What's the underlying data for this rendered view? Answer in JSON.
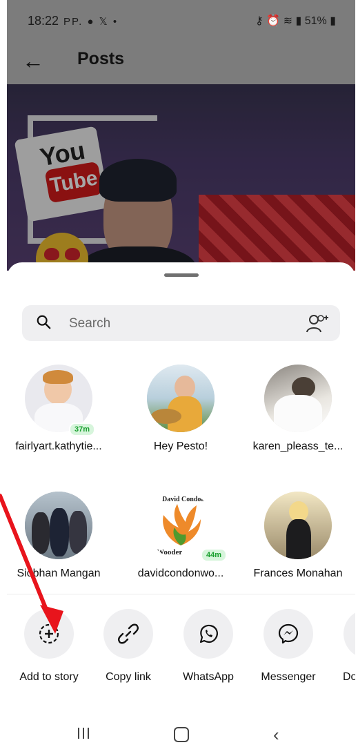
{
  "status_bar": {
    "time": "18:22",
    "left_icons": "PP. ● 𝕏 •",
    "battery": "51%"
  },
  "app_bar": {
    "title": "Posts"
  },
  "share_sheet": {
    "search": {
      "placeholder": "Search",
      "value": ""
    },
    "contacts": [
      {
        "name": "fairlyart.kathytie...",
        "badge": "37m"
      },
      {
        "name": "Hey Pesto!",
        "badge": ""
      },
      {
        "name": "karen_pleass_te...",
        "badge": ""
      },
      {
        "name": "Siobhan Mangan",
        "badge": ""
      },
      {
        "name": "davidcondonwo...",
        "badge": "44m",
        "logo_text_top": "David Condon",
        "logo_text_bottom": "Wooder"
      },
      {
        "name": "Frances Monahan",
        "badge": ""
      }
    ],
    "actions": [
      {
        "label": "Add to story",
        "icon": "add-story-icon"
      },
      {
        "label": "Copy link",
        "icon": "link-icon"
      },
      {
        "label": "WhatsApp",
        "icon": "whatsapp-icon"
      },
      {
        "label": "Messenger",
        "icon": "messenger-icon"
      },
      {
        "label": "Do",
        "icon": "download-icon"
      }
    ]
  },
  "annotation_color": "#e8141c"
}
